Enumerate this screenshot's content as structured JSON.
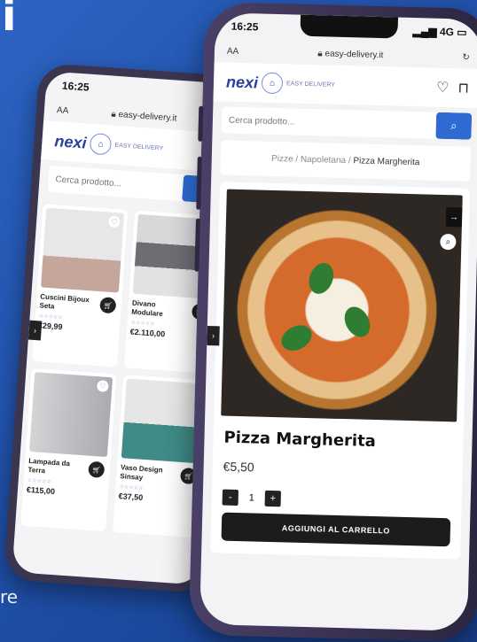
{
  "corner": {
    "top_letter": "i",
    "bottom_text": "re"
  },
  "back_phone": {
    "time": "16:25",
    "aa": "AA",
    "url": "easy-delivery.it",
    "logo_brand": "nexi",
    "logo_tagline": "EASY DELIVERY",
    "search_placeholder": "Cerca prodotto...",
    "products": [
      {
        "name": "Cuscini Bijoux Seta",
        "price": "€29,99",
        "stars": "☆☆☆☆☆"
      },
      {
        "name": "Divano Modulare",
        "price": "€2.110,00",
        "stars": "☆☆☆☆☆"
      },
      {
        "name": "Lampada da Terra",
        "price": "€115,00",
        "stars": "☆☆☆☆☆"
      },
      {
        "name": "Vaso Design Sinsay",
        "price": "€37,50",
        "stars": "☆☆☆☆☆"
      }
    ]
  },
  "front_phone": {
    "time": "16:25",
    "signal": "4G",
    "aa": "AA",
    "url": "easy-delivery.it",
    "logo_brand": "nexi",
    "logo_tagline": "EASY DELIVERY",
    "search_placeholder": "Cerca prodotto...",
    "breadcrumb": {
      "part1": "Pizze",
      "sep": " / ",
      "part2": "Napoletana",
      "current": "Pizza Margherita"
    },
    "product_title": "Pizza Margherita",
    "product_price": "€5,50",
    "quantity": "1",
    "qty_minus": "-",
    "qty_plus": "+",
    "cart_button": "AGGIUNGI AL CARRELLO"
  },
  "colors": {
    "accent": "#2e6ad1",
    "brand": "#2a3f9e",
    "background": "#2d64c4"
  }
}
